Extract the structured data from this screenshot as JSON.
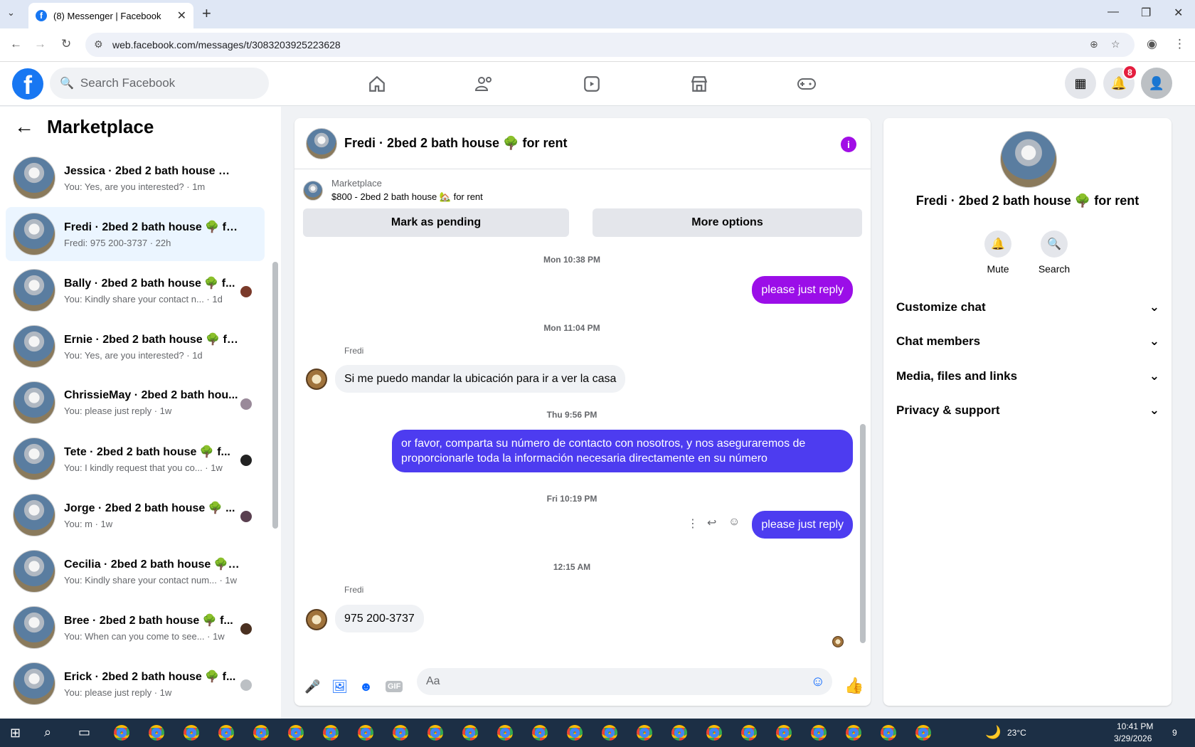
{
  "browser": {
    "tab_title": "(8) Messenger | Facebook",
    "tab_favicon": "f",
    "url": "web.facebook.com/messages/t/3083203925223628",
    "new_tab": "+",
    "back": "←",
    "forward": "→",
    "reload": "↻"
  },
  "facebook": {
    "logo": "f",
    "search_placeholder": "Search Facebook",
    "notification_count": "8"
  },
  "left": {
    "back_arrow": "←",
    "title": "Marketplace",
    "conversations": [
      {
        "name": "Jessica · 2bed 2 bath house 🌳 f...",
        "preview": "You: Yes, are you interested? · 1m",
        "active": false
      },
      {
        "name": "Fredi · 2bed 2 bath house 🌳 for...",
        "preview": "Fredi: 975 200-3737 · 22h",
        "active": true
      },
      {
        "name": "Bally · 2bed 2 bath house 🌳 f...",
        "preview": "You: Kindly share your contact n... · 1d",
        "active": false
      },
      {
        "name": "Ernie · 2bed 2 bath house 🌳 for...",
        "preview": "You: Yes, are you interested? · 1d",
        "active": false
      },
      {
        "name": "ChrissieMay · 2bed 2 bath hou...",
        "preview": "You: please just reply · 1w",
        "active": false
      },
      {
        "name": "Tete · 2bed 2 bath house 🌳 f...",
        "preview": "You: I kindly request that you co... · 1w",
        "active": false
      },
      {
        "name": "Jorge · 2bed 2 bath house 🌳 ...",
        "preview": "You: m · 1w",
        "active": false
      },
      {
        "name": "Cecilia · 2bed 2 bath house 🌳 f...",
        "preview": "You: Kindly share your contact num... · 1w",
        "active": false
      },
      {
        "name": "Bree · 2bed 2 bath house 🌳 f...",
        "preview": "You: When can you come to see... · 1w",
        "active": false
      },
      {
        "name": "Erick · 2bed 2 bath house 🌳 f...",
        "preview": "You: please just reply · 1w",
        "active": false
      }
    ]
  },
  "chat": {
    "title": "Fredi · 2bed 2 bath house 🌳 for rent",
    "info": "i",
    "marketplace_label": "Marketplace",
    "listing": "$800 - 2bed 2 bath house 🏡 for rent",
    "mark_pending": "Mark as pending",
    "more_options": "More options",
    "ts1": "Mon 10:38 PM",
    "msg1": "please just reply",
    "ts2": "Mon 11:04 PM",
    "sender1": "Fredi",
    "msg2": "Si me puedo mandar la ubicación para ir a ver la casa",
    "ts3": "Thu 9:56 PM",
    "msg3": "or favor, comparta su número de contacto con nosotros, y nos aseguraremos de proporcionarle toda la información necesaria directamente en su número",
    "ts4": "Fri 10:19 PM",
    "msg4": "please just reply",
    "ts5": "12:15 AM",
    "sender2": "Fredi",
    "msg5": "975 200-3737",
    "composer_placeholder": "Aa",
    "gif": "GIF"
  },
  "right": {
    "title": "Fredi · 2bed 2 bath house 🌳 for rent",
    "mute": "Mute",
    "search": "Search",
    "sections": [
      "Customize chat",
      "Chat members",
      "Media, files and links",
      "Privacy & support"
    ]
  },
  "taskbar": {
    "weather": "23°C",
    "time": "10:41 PM",
    "date": "3/29/2026",
    "notif": "9"
  }
}
